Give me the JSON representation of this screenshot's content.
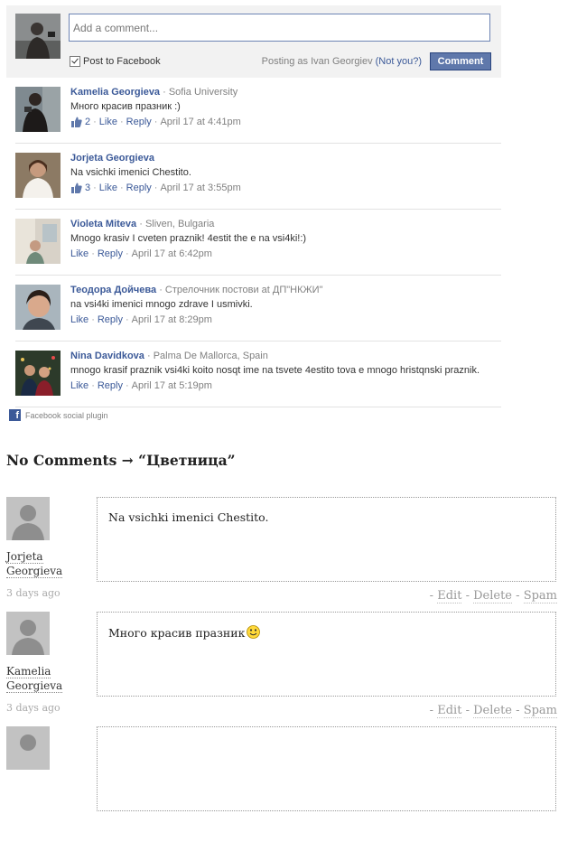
{
  "facebook": {
    "composer": {
      "placeholder": "Add a comment...",
      "post_to_facebook": "Post to Facebook",
      "posting_as": "Posting as Ivan Georgiev",
      "not_you": "(Not you?)",
      "button": "Comment"
    },
    "comments": [
      {
        "name": "Kamelia Georgieva",
        "sub": " · Sofia University",
        "text": "Много красив празник :)",
        "likes": "2",
        "like": "Like",
        "reply": "Reply",
        "time": "April 17 at 4:41pm"
      },
      {
        "name": "Jorjeta Georgieva",
        "sub": "",
        "text": "Na vsichki imenici Chestito.",
        "likes": "3",
        "like": "Like",
        "reply": "Reply",
        "time": "April 17 at 3:55pm"
      },
      {
        "name": "Violeta Miteva",
        "sub": " · Sliven, Bulgaria",
        "text": "Mnogo krasiv I cveten praznik! 4estit the e na vsi4ki!:)",
        "likes": "",
        "like": "Like",
        "reply": "Reply",
        "time": "April 17 at 6:42pm"
      },
      {
        "name": "Теодора Дойчева",
        "sub": " · Стрелочник постови at ДП\"НКЖИ\"",
        "text": "na vsi4ki imenici mnogo zdrave I usmivki.",
        "likes": "",
        "like": "Like",
        "reply": "Reply",
        "time": "April 17 at 8:29pm"
      },
      {
        "name": "Nina Davidkova",
        "sub": " · Palma De Mallorca, Spain",
        "text": "mnogo krasif praznik vsi4ki koito nosqt ime na tsvete 4estito tova e mnogo hristqnski praznik.",
        "likes": "",
        "like": "Like",
        "reply": "Reply",
        "time": "April 17 at 5:19pm"
      }
    ],
    "footer": "Facebook social plugin",
    "brand_color": "#3b5998"
  },
  "wordpress": {
    "title": "No Comments → “Цветница”",
    "comments": [
      {
        "author_line1": "Jorjeta",
        "author_line2": "Georgieva",
        "date": "3 days ago",
        "text": "Na vsichki imenici Chestito.",
        "edit": "Edit",
        "delete": "Delete",
        "spam": "Spam",
        "sep": "-"
      },
      {
        "author_line1": "Kamelia",
        "author_line2": "Georgieva",
        "date": "3 days ago",
        "text": "Много красив празник",
        "edit": "Edit",
        "delete": "Delete",
        "spam": "Spam",
        "sep": "-"
      }
    ]
  }
}
